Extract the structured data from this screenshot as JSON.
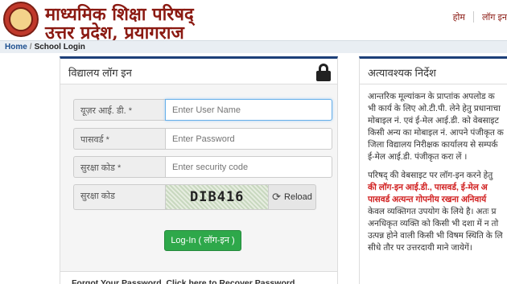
{
  "header": {
    "title_line1": "माध्यमिक शिक्षा परिषद्",
    "title_line2": "उत्तर प्रदेश, प्रयागराज",
    "nav": [
      "होम",
      "लॉग इन"
    ]
  },
  "breadcrumb": {
    "home": "Home",
    "separator": "/",
    "current": "School Login"
  },
  "login": {
    "heading": "विद्यालय लॉग इन",
    "user_label": "यूज़र आई. डी. *",
    "user_placeholder": "Enter User Name",
    "password_label": "पासवर्ड *",
    "password_placeholder": "Enter Password",
    "security_label": "सुरक्षा कोड *",
    "security_placeholder": "Enter security code",
    "captcha_label": "सुरक्षा कोड",
    "captcha_text": "DIB416",
    "reload_label": "Reload",
    "login_button": "Log-In ( लॉग-इन )",
    "forgot_text": "Forgot Your Password, Click here to Recover Password"
  },
  "notice": {
    "heading": "अत्यावश्यक निर्देश",
    "p1": [
      "आन्तरिक मूल्यांकन के प्राप्तांक अपलोड क",
      "भी कार्य के लिए ओ.टी.पी. लेने हेतु प्रधानाचा",
      "मोबाइल नं. एवं ई-मेल आई.डी. को वेबसाइट",
      "किसी अन्य का मोबाइल नं. आपने पंजीकृत क",
      "जिला विद्यालय निरीक्षक कार्यालय से सम्पर्क",
      "ई-मेल आई.डी. पंजीकृत करा लें ।"
    ],
    "p2_line1": "परिषद् की वेबसाइट पर लॉग-इन करने हेतु",
    "p2_red1": "की लॉग-इन आई.डी., पासवर्ड, ई-मेल अ",
    "p2_red2": "पासवर्ड अत्यन्त गोपनीय रखना अनिवार्य",
    "p2_rest": [
      "केवल व्यक्तिगत उपयोग के लिये है। अतः प्र",
      "अनधिकृत व्यक्ति को किसी भी दशा में न तो",
      "उत्पन्न होने वाली किसी भी विषम स्थिति के लि",
      "सीधे तौर पर उत्तरदायी माने जायेगें।"
    ]
  },
  "colors": {
    "brand": "#8b1a12",
    "panel_top": "#1c3f79",
    "login_button": "#2ea84a",
    "notice_red": "#d12020"
  },
  "icons": [
    "logo-seal",
    "lock-icon",
    "reload-icon"
  ]
}
